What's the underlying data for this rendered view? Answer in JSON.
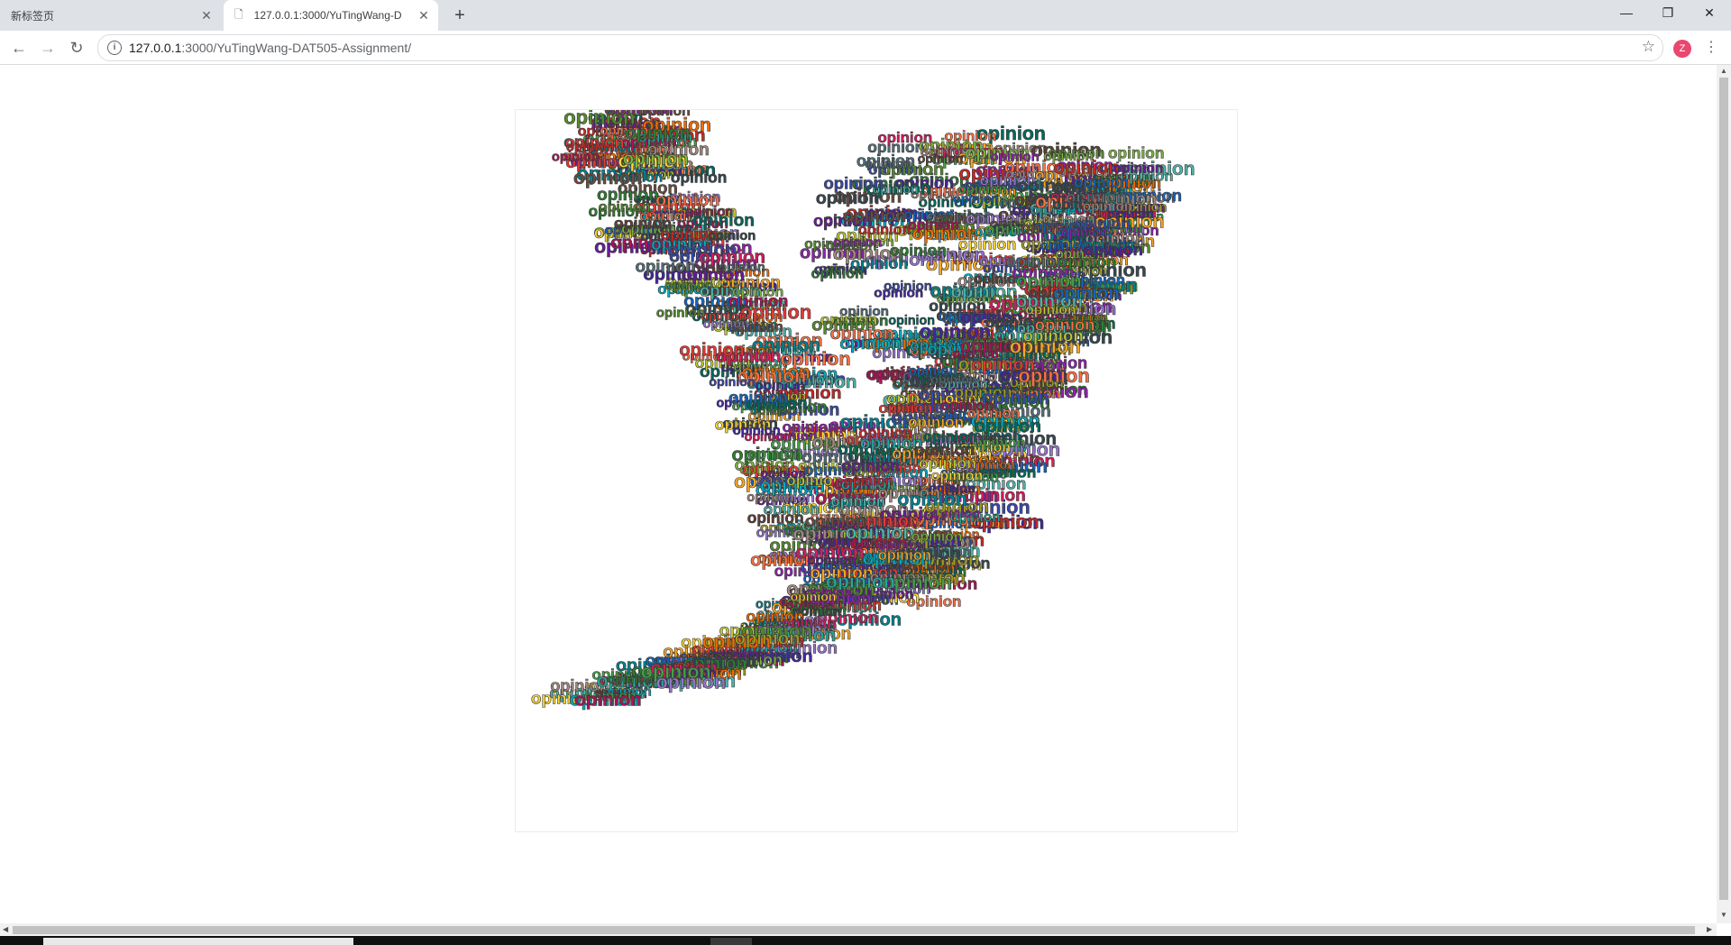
{
  "browser": {
    "tabs": [
      {
        "label": "新标签页",
        "active": false
      },
      {
        "label": "127.0.0.1:3000/YuTingWang-D",
        "active": true
      }
    ],
    "new_tab_label": "+",
    "url_host": "127.0.0.1",
    "url_rest": ":3000/YuTingWang-DAT505-Assignment/",
    "avatar_letter": "Z",
    "icons": {
      "back": "back-arrow-icon",
      "forward": "forward-arrow-icon",
      "reload": "reload-icon",
      "info": "info-icon",
      "star": "star-icon",
      "menu": "more-vert-icon",
      "minimize": "minimize-icon",
      "restore": "restore-icon",
      "close": "close-icon"
    }
  },
  "page": {
    "word": "opinion",
    "palette": [
      "#2e7d32",
      "#6a1b9a",
      "#c62828",
      "#1565c0",
      "#00838f",
      "#ef6c00",
      "#558b2f",
      "#ad1457",
      "#4527a0",
      "#37474f",
      "#9e9d24",
      "#5d4037",
      "#00695c",
      "#f9a825",
      "#8e24aa",
      "#43a047",
      "#e53935",
      "#3949ab",
      "#26a69a",
      "#7cb342",
      "#d81b60",
      "#6d4c41",
      "#546e7a",
      "#c0ca33",
      "#fdd835",
      "#00acc1",
      "#a1887f",
      "#ff7043",
      "#9575cd",
      "#4db6ac"
    ]
  }
}
